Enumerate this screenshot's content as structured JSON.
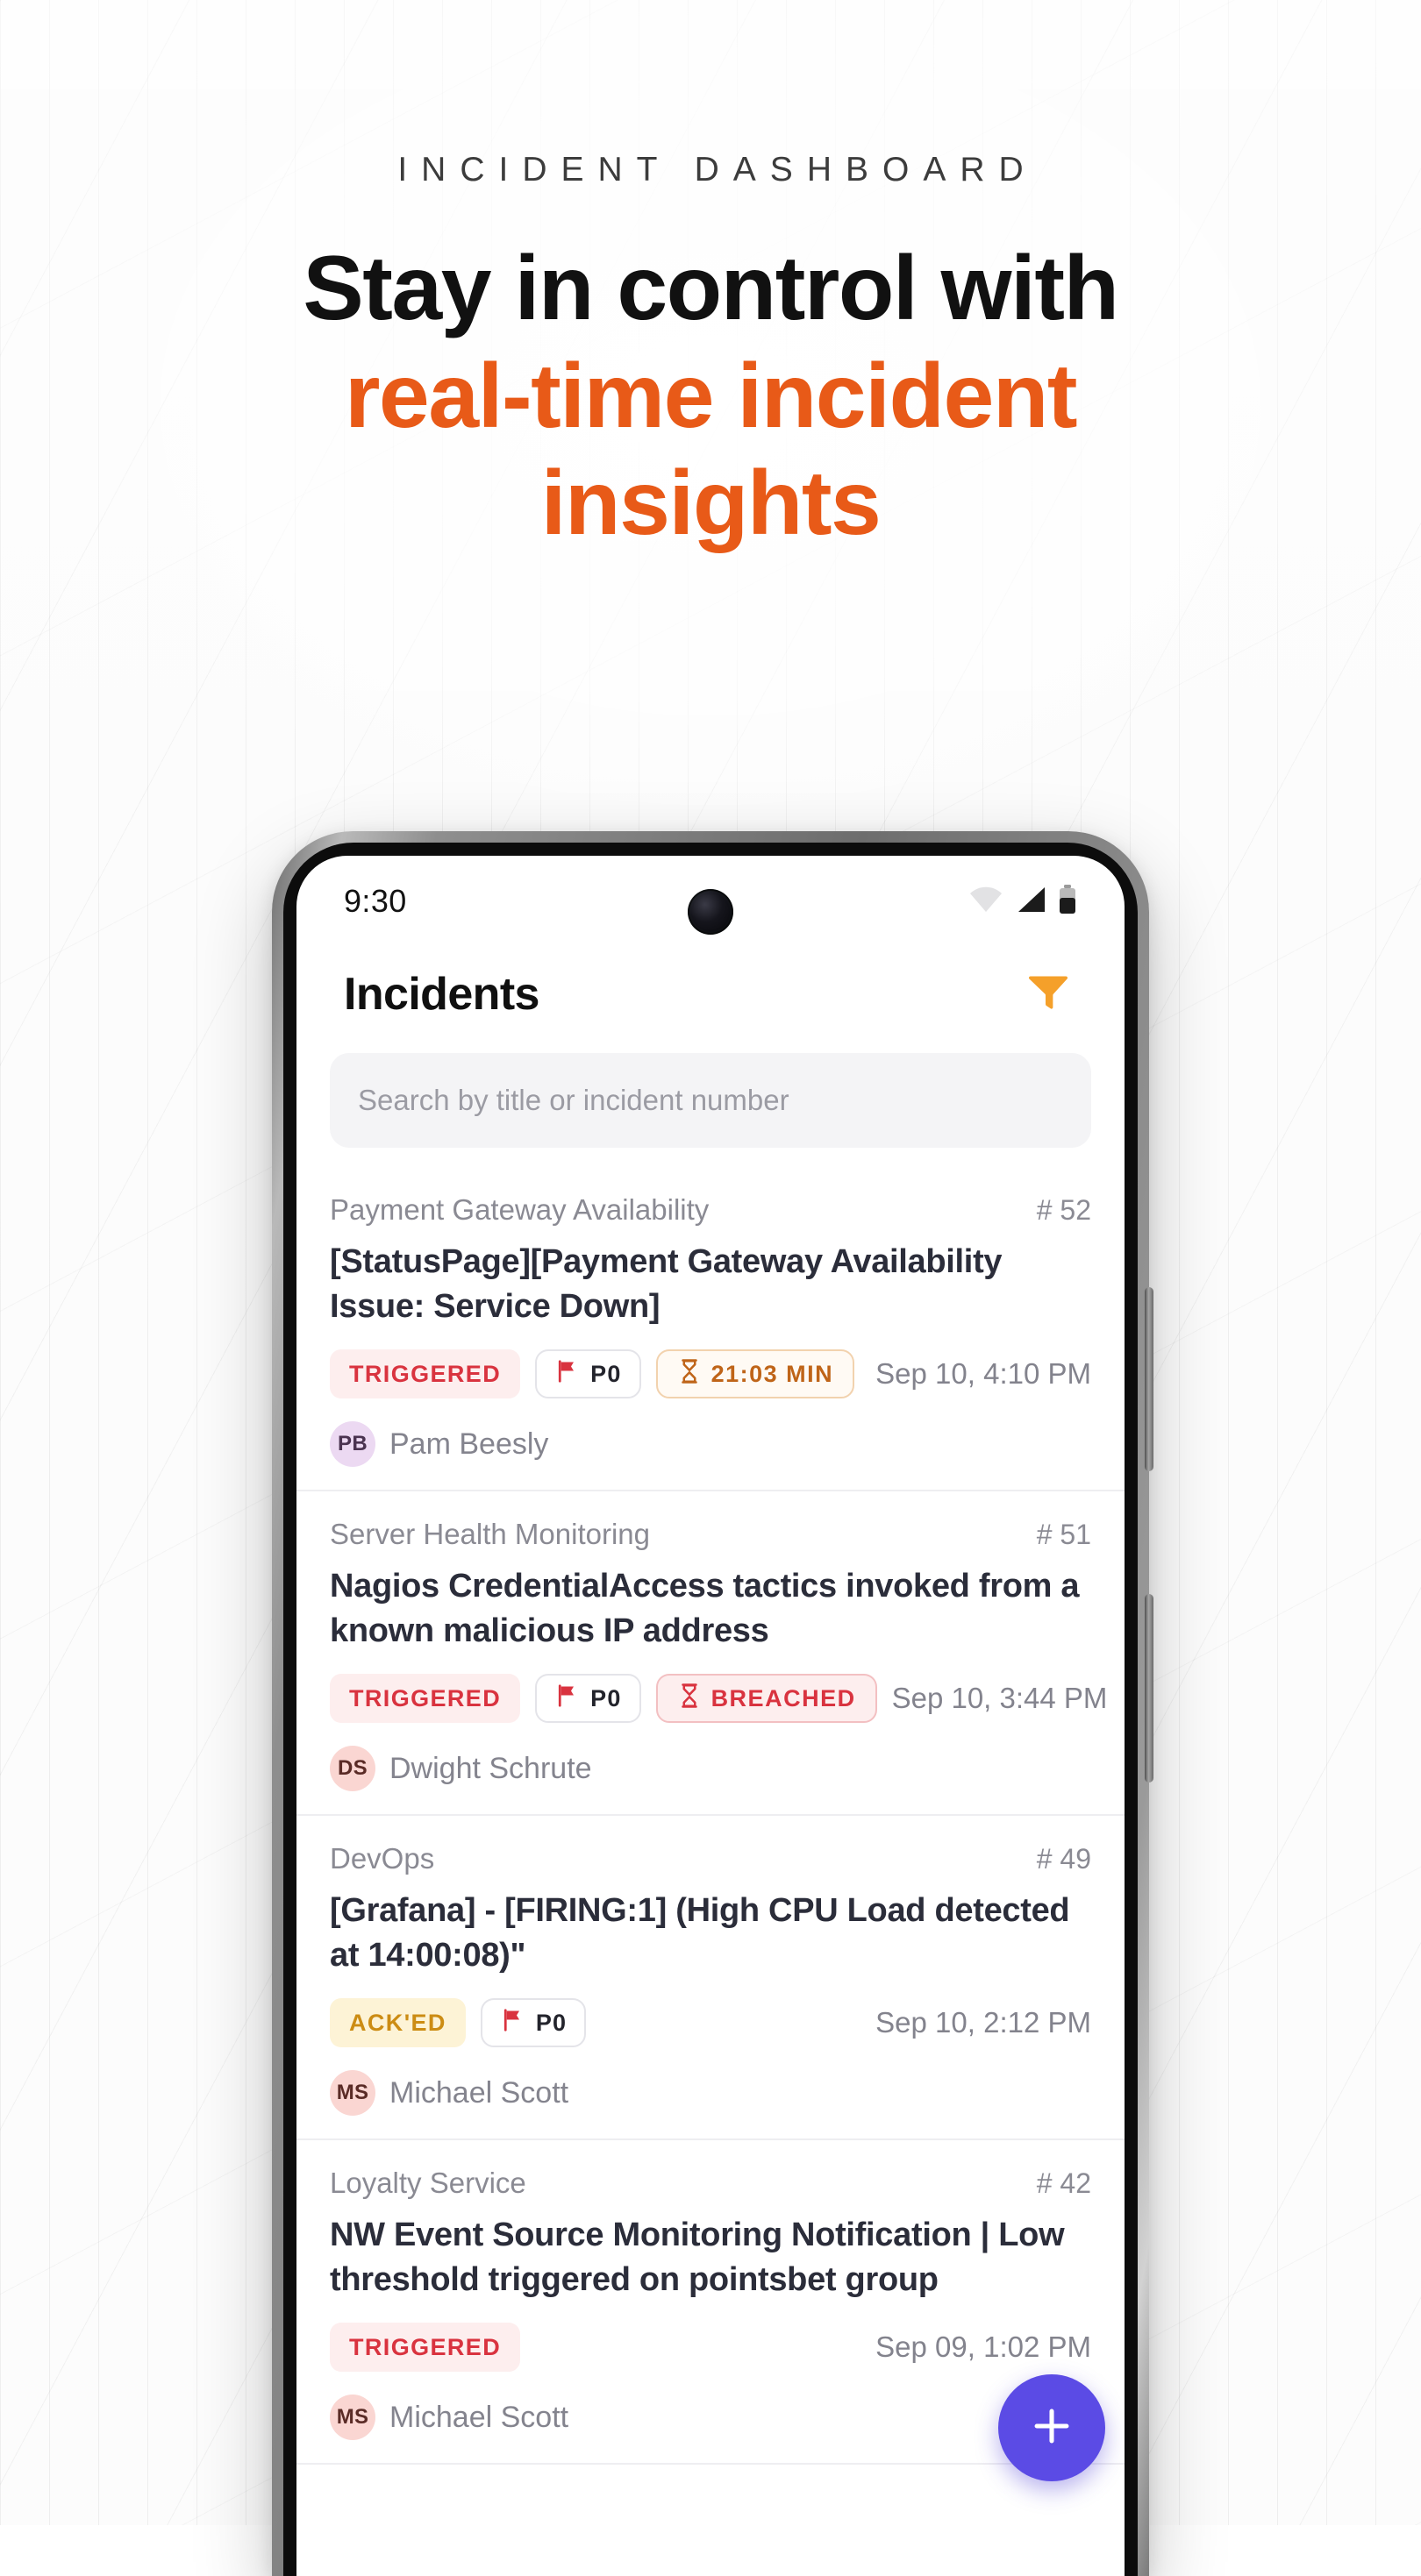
{
  "hero": {
    "eyebrow": "INCIDENT DASHBOARD",
    "headline_line1": "Stay in control with",
    "headline_line2": "real-time incident",
    "headline_line3": "insights",
    "accent_color": "#E85A18"
  },
  "phone": {
    "status_bar": {
      "time": "9:30",
      "icons": [
        "wifi-icon",
        "cellular-signal-icon",
        "battery-icon"
      ]
    },
    "app_bar": {
      "title": "Incidents",
      "filter_icon": "filter-funnel-icon",
      "filter_color": "#F5A02A"
    },
    "search": {
      "placeholder": "Search by title or incident number",
      "value": ""
    },
    "fab": {
      "icon": "plus-icon",
      "color": "#5B4BE5"
    },
    "incidents": [
      {
        "service": "Payment Gateway Availability",
        "number": "# 52",
        "title": "[StatusPage][Payment Gateway Availability Issue: Service Down]",
        "status": "TRIGGERED",
        "status_kind": "triggered",
        "priority": "P0",
        "extra_badge": "21:03 MIN",
        "extra_badge_kind": "timer",
        "extra_badge_icon": "hourglass-icon",
        "time": "Sep 10, 4:10 PM",
        "user_initials": "PB",
        "user_name": "Pam Beesly",
        "avatar_kind": "purple"
      },
      {
        "service": "Server Health Monitoring",
        "number": "# 51",
        "title": "Nagios CredentialAccess tactics invoked from a known malicious IP address",
        "status": "TRIGGERED",
        "status_kind": "triggered",
        "priority": "P0",
        "extra_badge": "BREACHED",
        "extra_badge_kind": "breached",
        "extra_badge_icon": "hourglass-icon",
        "time": "Sep 10, 3:44 PM",
        "user_initials": "DS",
        "user_name": "Dwight Schrute",
        "avatar_kind": "pink"
      },
      {
        "service": "DevOps",
        "number": "# 49",
        "title": "[Grafana] - [FIRING:1] (High CPU Load detected at 14:00:08)\"",
        "status": "ACK'ED",
        "status_kind": "acked",
        "priority": "P0",
        "extra_badge": "",
        "extra_badge_kind": "none",
        "extra_badge_icon": "",
        "time": "Sep 10, 2:12 PM",
        "user_initials": "MS",
        "user_name": "Michael Scott",
        "avatar_kind": "pink"
      },
      {
        "service": "Loyalty Service",
        "number": "# 42",
        "title": "NW Event Source Monitoring Notification | Low threshold triggered on pointsbet group",
        "status": "TRIGGERED",
        "status_kind": "triggered",
        "priority": "",
        "extra_badge": "",
        "extra_badge_kind": "none",
        "extra_badge_icon": "",
        "time": "Sep 09, 1:02 PM",
        "user_initials": "MS",
        "user_name": "Michael Scott",
        "avatar_kind": "pink"
      }
    ]
  }
}
